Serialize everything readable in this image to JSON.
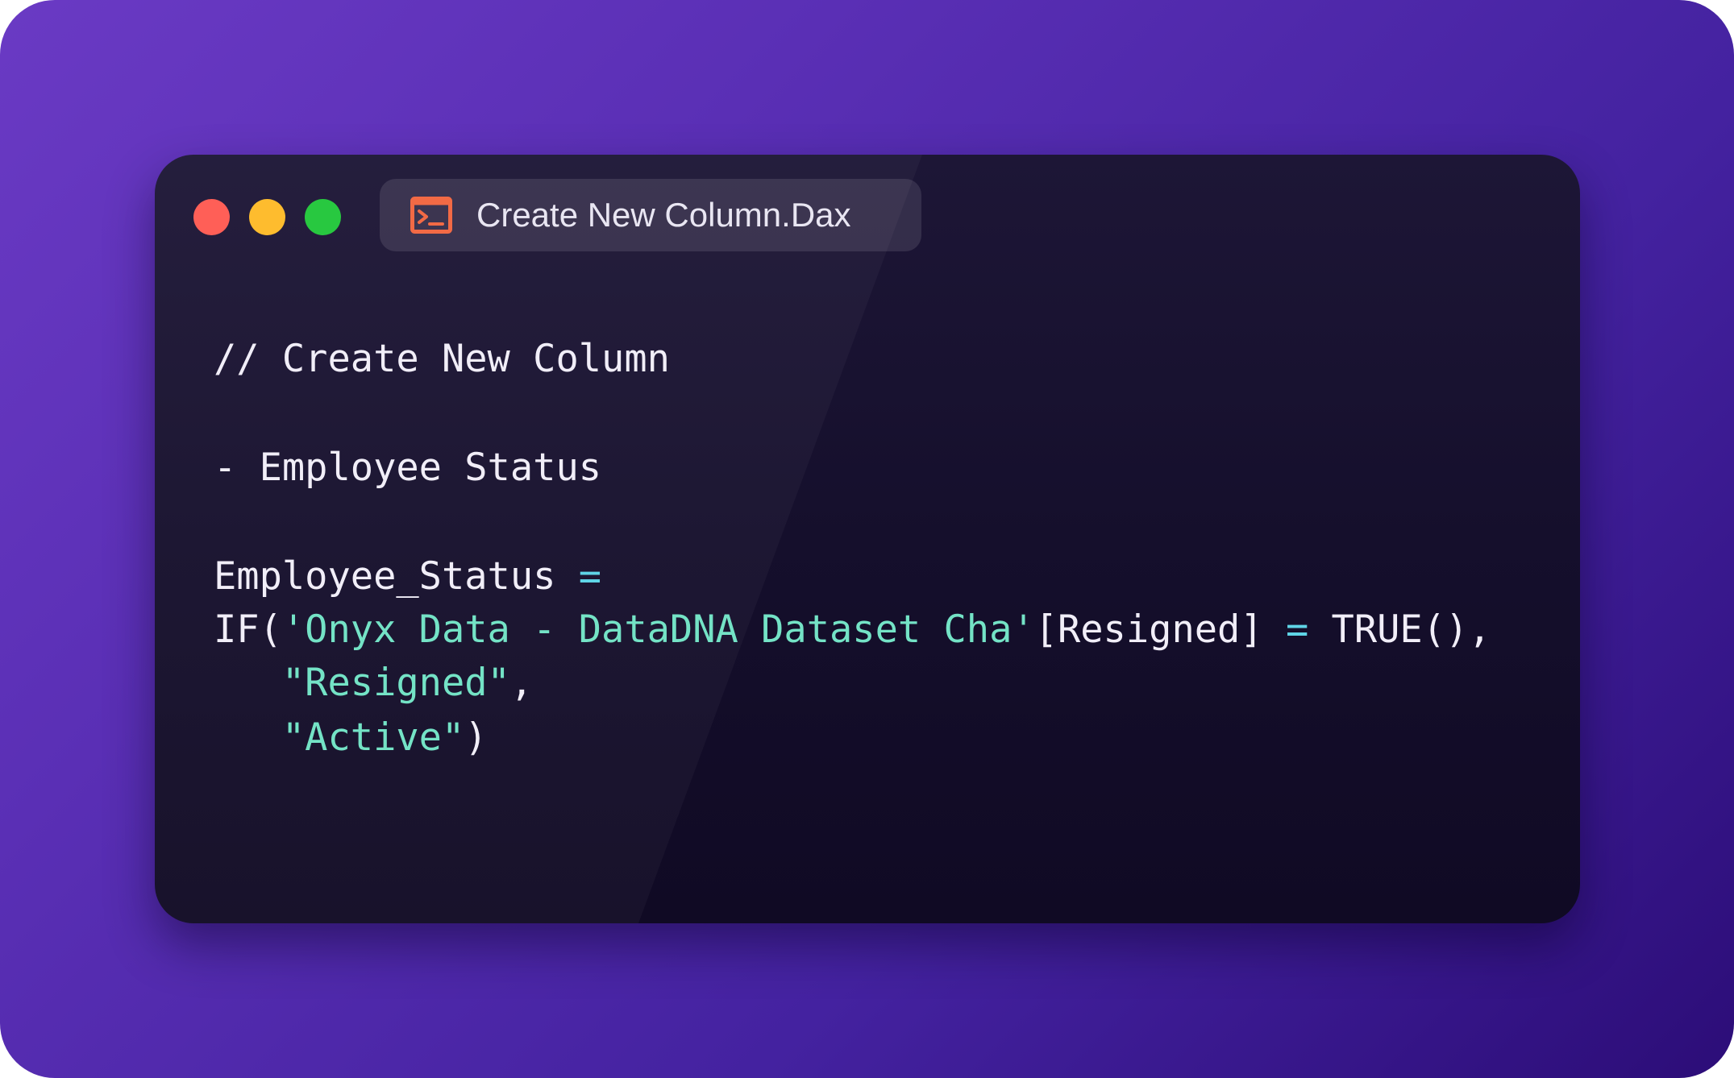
{
  "window": {
    "controls": {
      "close_color": "#ff5f57",
      "minimize_color": "#febc2e",
      "maximize_color": "#28c840"
    },
    "tab": {
      "icon": "terminal-icon",
      "title": "Create New Column.Dax"
    }
  },
  "colors": {
    "background_start": "#6a3ac4",
    "background_end": "#2c0d78",
    "window_bg": "#150f2c",
    "text": "#f1eef8",
    "string": "#74e3c6",
    "operator": "#5fd4e6",
    "icon_accent": "#f26a45"
  },
  "code": {
    "comment": "// Create New Column",
    "subtitle": "- Employee Status",
    "assign_name": "Employee_Status ",
    "assign_op": "=",
    "if_open": "IF(",
    "table_ref": "'Onyx Data - DataDNA Dataset Cha'",
    "column_ref": "[Resigned] ",
    "eq_op": "=",
    "true_call": " TRUE(),",
    "indent": "   ",
    "str_resigned": "\"Resigned\"",
    "comma": ",",
    "str_active": "\"Active\"",
    "close_paren": ")"
  }
}
